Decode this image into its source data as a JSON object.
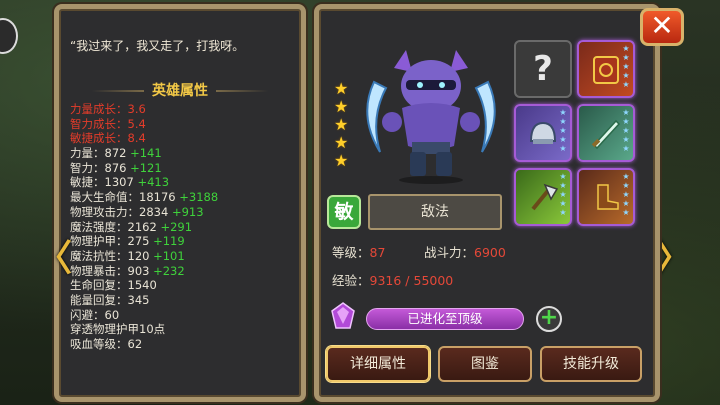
{
  "quote": "“我过来了，我又走了，打我呀。",
  "attributes_title": "英雄属性",
  "growth": [
    {
      "label": "力量成长：",
      "value": "3.6"
    },
    {
      "label": "智力成长：",
      "value": "5.4"
    },
    {
      "label": "敏捷成长：",
      "value": "8.4"
    }
  ],
  "stats": [
    {
      "label": "力量：",
      "value": "872",
      "bonus": "+141"
    },
    {
      "label": "智力：",
      "value": "876",
      "bonus": "+121"
    },
    {
      "label": "敏捷：",
      "value": "1307",
      "bonus": "+413"
    },
    {
      "label": "最大生命值：",
      "value": "18176",
      "bonus": "+3188"
    },
    {
      "label": "物理攻击力：",
      "value": "2834",
      "bonus": "+913"
    },
    {
      "label": "魔法强度：",
      "value": "2162",
      "bonus": "+291"
    },
    {
      "label": "物理护甲：",
      "value": "275",
      "bonus": "+119"
    },
    {
      "label": "魔法抗性：",
      "value": "120",
      "bonus": "+101"
    },
    {
      "label": "物理暴击：",
      "value": "903",
      "bonus": "+232"
    },
    {
      "label": "生命回复：",
      "value": "1540",
      "bonus": ""
    },
    {
      "label": "能量回复：",
      "value": "345",
      "bonus": ""
    },
    {
      "label": "闪避：",
      "value": "60",
      "bonus": ""
    },
    {
      "label": "穿透物理护甲",
      "value": "10点",
      "bonus": ""
    },
    {
      "label": "吸血等级：",
      "value": "62",
      "bonus": ""
    }
  ],
  "hero": {
    "name": "敌法",
    "class_badge": "敏",
    "star_count": 5,
    "level_label": "等级：",
    "level": "87",
    "power_label": "战斗力：",
    "power": "6900",
    "exp_label": "经验：",
    "exp": "9316 / 55000",
    "evolve_status": "已进化至顶级"
  },
  "equipment": [
    {
      "name": "unknown-slot",
      "label": "?"
    },
    {
      "name": "spellbook",
      "label": ""
    },
    {
      "name": "helmet",
      "label": ""
    },
    {
      "name": "blade",
      "label": ""
    },
    {
      "name": "axe",
      "label": ""
    },
    {
      "name": "boots",
      "label": ""
    }
  ],
  "buttons": {
    "details": "详细属性",
    "codex": "图鉴",
    "skill_upgrade": "技能升级",
    "close": "✕"
  },
  "nav": {
    "prev": "〈",
    "next": "〉"
  },
  "colors": {
    "gold_text": "#f2c846",
    "growth_red": "#e43c2a",
    "bonus_green": "#3fd23b",
    "panel_border": "#a8946c",
    "evolve_purple": "#b048c8"
  }
}
